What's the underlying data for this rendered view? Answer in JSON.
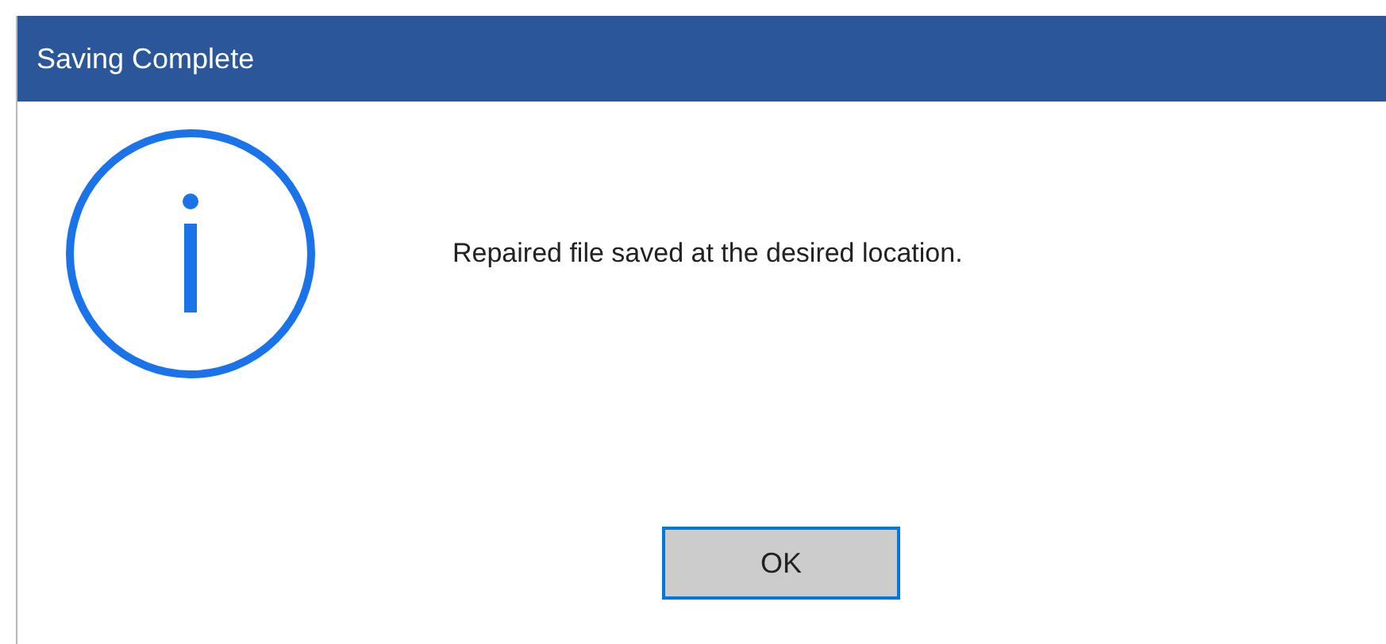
{
  "window": {
    "title": "Saving Complete"
  },
  "message": "Repaired file saved at the desired location.",
  "buttons": [
    {
      "label": "OK",
      "focused": true
    }
  ]
}
